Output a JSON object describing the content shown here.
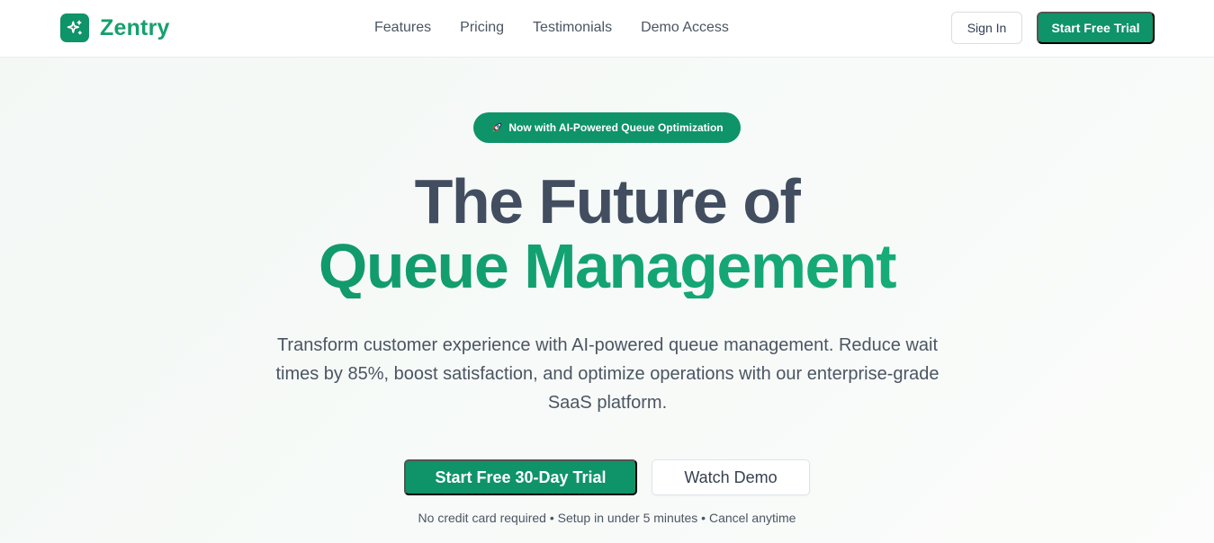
{
  "brand": {
    "name": "Zentry",
    "logo_icon": "sparkles-icon",
    "color": "#0f9368"
  },
  "nav": {
    "links": [
      "Features",
      "Pricing",
      "Testimonials",
      "Demo Access"
    ],
    "sign_in": "Sign In",
    "start_trial": "Start Free Trial"
  },
  "hero": {
    "badge_icon": "rocket-icon",
    "badge": "Now with AI-Powered Queue Optimization",
    "headline_line1": "The Future of",
    "headline_line2": "Queue Management",
    "subtitle": "Transform customer experience with AI-powered queue management. Reduce wait times by 85%, boost satisfaction, and optimize operations with our enterprise-grade SaaS platform.",
    "cta_primary": "Start Free 30-Day Trial",
    "cta_secondary": "Watch Demo",
    "note": "No credit card required • Setup in under 5 minutes • Cancel anytime"
  },
  "colors": {
    "accent": "#0f9368",
    "headline_dark": "#424e60",
    "headline_green": "#14a574"
  }
}
